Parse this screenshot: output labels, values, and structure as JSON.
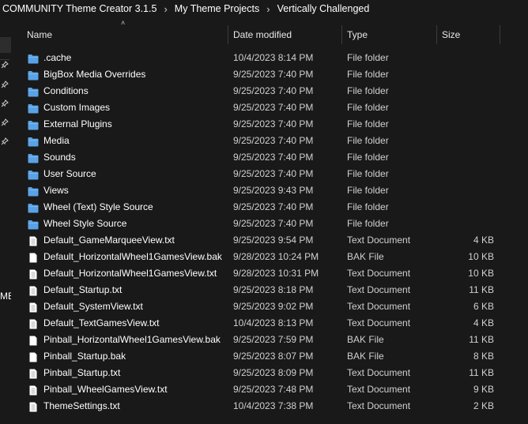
{
  "breadcrumb": {
    "items": [
      "COMMUNITY Theme Creator 3.1.5",
      "My Theme Projects",
      "Vertically Challenged"
    ],
    "separator": "›"
  },
  "left_pane": {
    "partial_text": "ME"
  },
  "columns": {
    "name": "Name",
    "date": "Date modified",
    "type": "Type",
    "size": "Size"
  },
  "files": [
    {
      "name": ".cache",
      "date": "10/4/2023 8:14 PM",
      "type": "File folder",
      "size": "",
      "icon": "folder-icon"
    },
    {
      "name": "BigBox Media Overrides",
      "date": "9/25/2023 7:40 PM",
      "type": "File folder",
      "size": "",
      "icon": "folder-icon"
    },
    {
      "name": "Conditions",
      "date": "9/25/2023 7:40 PM",
      "type": "File folder",
      "size": "",
      "icon": "folder-icon"
    },
    {
      "name": "Custom Images",
      "date": "9/25/2023 7:40 PM",
      "type": "File folder",
      "size": "",
      "icon": "folder-icon"
    },
    {
      "name": "External Plugins",
      "date": "9/25/2023 7:40 PM",
      "type": "File folder",
      "size": "",
      "icon": "folder-icon"
    },
    {
      "name": "Media",
      "date": "9/25/2023 7:40 PM",
      "type": "File folder",
      "size": "",
      "icon": "folder-icon"
    },
    {
      "name": "Sounds",
      "date": "9/25/2023 7:40 PM",
      "type": "File folder",
      "size": "",
      "icon": "folder-icon"
    },
    {
      "name": "User Source",
      "date": "9/25/2023 7:40 PM",
      "type": "File folder",
      "size": "",
      "icon": "folder-icon"
    },
    {
      "name": "Views",
      "date": "9/25/2023 9:43 PM",
      "type": "File folder",
      "size": "",
      "icon": "folder-icon"
    },
    {
      "name": "Wheel (Text) Style Source",
      "date": "9/25/2023 7:40 PM",
      "type": "File folder",
      "size": "",
      "icon": "folder-icon"
    },
    {
      "name": "Wheel Style Source",
      "date": "9/25/2023 7:40 PM",
      "type": "File folder",
      "size": "",
      "icon": "folder-icon"
    },
    {
      "name": "Default_GameMarqueeView.txt",
      "date": "9/25/2023 9:54 PM",
      "type": "Text Document",
      "size": "4 KB",
      "icon": "text-file-icon"
    },
    {
      "name": "Default_HorizontalWheel1GamesView.bak",
      "date": "9/28/2023 10:24 PM",
      "type": "BAK File",
      "size": "10 KB",
      "icon": "blank-file-icon"
    },
    {
      "name": "Default_HorizontalWheel1GamesView.txt",
      "date": "9/28/2023 10:31 PM",
      "type": "Text Document",
      "size": "10 KB",
      "icon": "text-file-icon"
    },
    {
      "name": "Default_Startup.txt",
      "date": "9/25/2023 8:18 PM",
      "type": "Text Document",
      "size": "11 KB",
      "icon": "text-file-icon"
    },
    {
      "name": "Default_SystemView.txt",
      "date": "9/25/2023 9:02 PM",
      "type": "Text Document",
      "size": "6 KB",
      "icon": "text-file-icon"
    },
    {
      "name": "Default_TextGamesView.txt",
      "date": "10/4/2023 8:13 PM",
      "type": "Text Document",
      "size": "4 KB",
      "icon": "text-file-icon"
    },
    {
      "name": "Pinball_HorizontalWheel1GamesView.bak",
      "date": "9/25/2023 7:59 PM",
      "type": "BAK File",
      "size": "11 KB",
      "icon": "blank-file-icon"
    },
    {
      "name": "Pinball_Startup.bak",
      "date": "9/25/2023 8:07 PM",
      "type": "BAK File",
      "size": "8 KB",
      "icon": "blank-file-icon"
    },
    {
      "name": "Pinball_Startup.txt",
      "date": "9/25/2023 8:09 PM",
      "type": "Text Document",
      "size": "11 KB",
      "icon": "text-file-icon"
    },
    {
      "name": "Pinball_WheelGamesView.txt",
      "date": "9/25/2023 7:48 PM",
      "type": "Text Document",
      "size": "9 KB",
      "icon": "text-file-icon"
    },
    {
      "name": "ThemeSettings.txt",
      "date": "10/4/2023 7:38 PM",
      "type": "Text Document",
      "size": "2 KB",
      "icon": "text-file-icon"
    }
  ],
  "colors": {
    "background": "#191919",
    "folder": "#5aa2e6",
    "file": "#ffffff"
  }
}
